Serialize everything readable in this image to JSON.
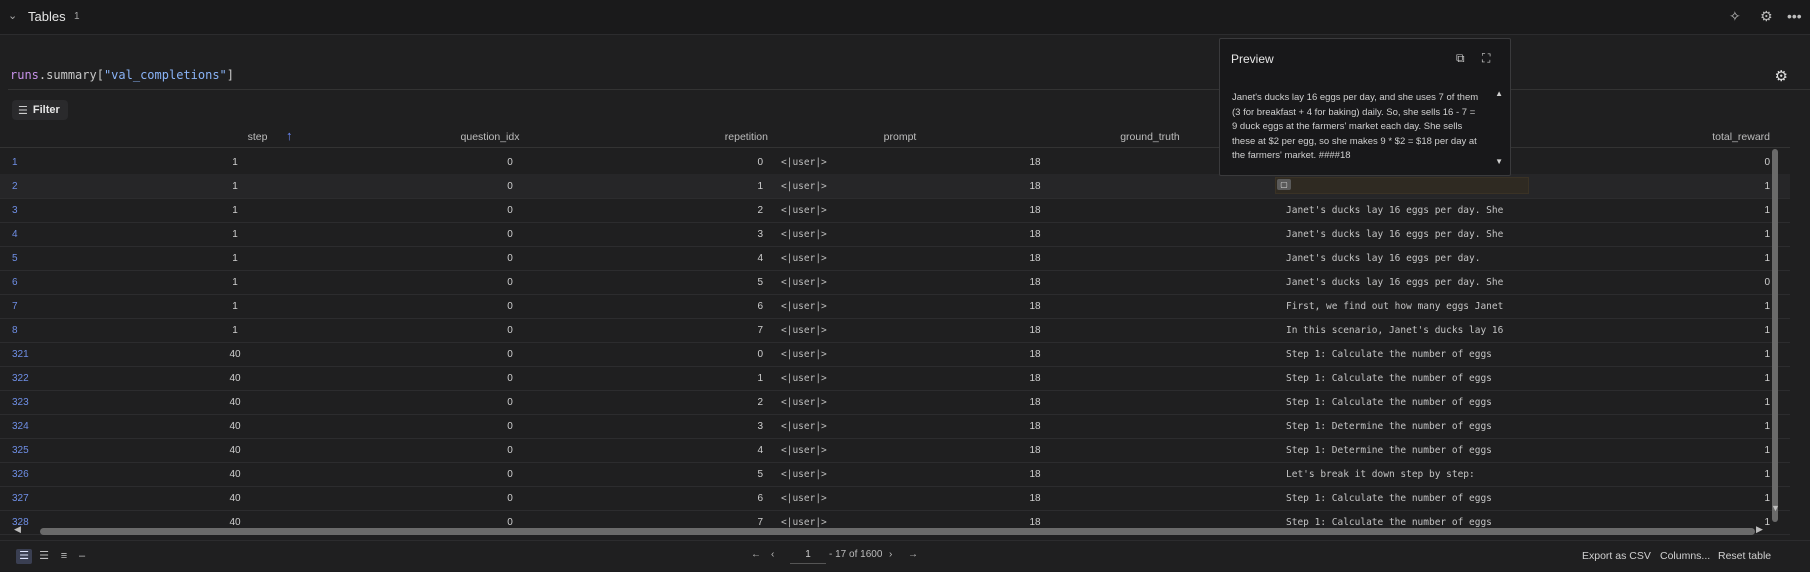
{
  "topbar": {
    "title": "Tables",
    "count": "1"
  },
  "panel": {
    "expr": {
      "obj": "runs",
      "dot": ".",
      "attr": "summary",
      "open": "[",
      "key": "\"val_completions\"",
      "close": "]"
    },
    "filter_label": "Filter"
  },
  "columns": [
    "step",
    "question_idx",
    "repetition",
    "prompt",
    "ground_truth",
    "total_reward"
  ],
  "rows": [
    {
      "idx": "1",
      "step": "1",
      "q": "0",
      "rep": "0",
      "prompt": "<|user|>",
      "gt": "18",
      "comp": "",
      "tr": "0"
    },
    {
      "idx": "2",
      "step": "1",
      "q": "0",
      "rep": "1",
      "prompt": "<|user|>",
      "gt": "18",
      "comp": "Janet's ducks lay 16 eggs per day, and",
      "tr": "1"
    },
    {
      "idx": "3",
      "step": "1",
      "q": "0",
      "rep": "2",
      "prompt": "<|user|>",
      "gt": "18",
      "comp": "Janet's ducks lay 16 eggs per day. She",
      "tr": "1"
    },
    {
      "idx": "4",
      "step": "1",
      "q": "0",
      "rep": "3",
      "prompt": "<|user|>",
      "gt": "18",
      "comp": "Janet's ducks lay 16 eggs per day. She",
      "tr": "1"
    },
    {
      "idx": "5",
      "step": "1",
      "q": "0",
      "rep": "4",
      "prompt": "<|user|>",
      "gt": "18",
      "comp": "Janet's ducks lay 16 eggs per day.",
      "tr": "1"
    },
    {
      "idx": "6",
      "step": "1",
      "q": "0",
      "rep": "5",
      "prompt": "<|user|>",
      "gt": "18",
      "comp": "Janet's ducks lay 16 eggs per day. She",
      "tr": "0"
    },
    {
      "idx": "7",
      "step": "1",
      "q": "0",
      "rep": "6",
      "prompt": "<|user|>",
      "gt": "18",
      "comp": "First, we find out how many eggs Janet",
      "tr": "1"
    },
    {
      "idx": "8",
      "step": "1",
      "q": "0",
      "rep": "7",
      "prompt": "<|user|>",
      "gt": "18",
      "comp": "In this scenario, Janet's ducks lay 16",
      "tr": "1"
    },
    {
      "idx": "321",
      "step": "40",
      "q": "0",
      "rep": "0",
      "prompt": "<|user|>",
      "gt": "18",
      "comp": "Step 1: Calculate the number of eggs",
      "tr": "1"
    },
    {
      "idx": "322",
      "step": "40",
      "q": "0",
      "rep": "1",
      "prompt": "<|user|>",
      "gt": "18",
      "comp": "Step 1: Calculate the number of eggs",
      "tr": "1"
    },
    {
      "idx": "323",
      "step": "40",
      "q": "0",
      "rep": "2",
      "prompt": "<|user|>",
      "gt": "18",
      "comp": "Step 1: Calculate the number of eggs",
      "tr": "1"
    },
    {
      "idx": "324",
      "step": "40",
      "q": "0",
      "rep": "3",
      "prompt": "<|user|>",
      "gt": "18",
      "comp": "Step 1: Determine the number of eggs",
      "tr": "1"
    },
    {
      "idx": "325",
      "step": "40",
      "q": "0",
      "rep": "4",
      "prompt": "<|user|>",
      "gt": "18",
      "comp": "Step 1: Determine the number of eggs",
      "tr": "1"
    },
    {
      "idx": "326",
      "step": "40",
      "q": "0",
      "rep": "5",
      "prompt": "<|user|>",
      "gt": "18",
      "comp": "Let's break it down step by step:",
      "tr": "1"
    },
    {
      "idx": "327",
      "step": "40",
      "q": "0",
      "rep": "6",
      "prompt": "<|user|>",
      "gt": "18",
      "comp": "Step 1: Calculate the number of eggs",
      "tr": "1"
    },
    {
      "idx": "328",
      "step": "40",
      "q": "0",
      "rep": "7",
      "prompt": "<|user|>",
      "gt": "18",
      "comp": "Step 1: Calculate the number of eggs",
      "tr": "1"
    }
  ],
  "preview": {
    "title": "Preview",
    "text": " Janet's ducks lay 16 eggs per day, and she uses 7 of them (3 for breakfast + 4 for baking) daily. So, she sells 16 - 7 = 9 duck eggs at the farmers' market each day. She sells these at $2 per egg, so she makes 9 * $2 = $18 per day at the farmers' market. ####18"
  },
  "pagination": {
    "page": "1",
    "range": "- 17 of 1600"
  },
  "bottom": {
    "export": "Export as CSV",
    "columns": "Columns...",
    "reset": "Reset table"
  },
  "icons": [
    "chevron-down-icon",
    "sparkle-icon",
    "gear-icon",
    "more-icon",
    "filter-icon",
    "copy-icon",
    "expand-icon",
    "table-view-icon",
    "list-view-icon",
    "compact-view-icon",
    "collapse-view-icon",
    "first-page-icon",
    "prev-page-icon",
    "next-page-icon",
    "last-page-icon"
  ]
}
